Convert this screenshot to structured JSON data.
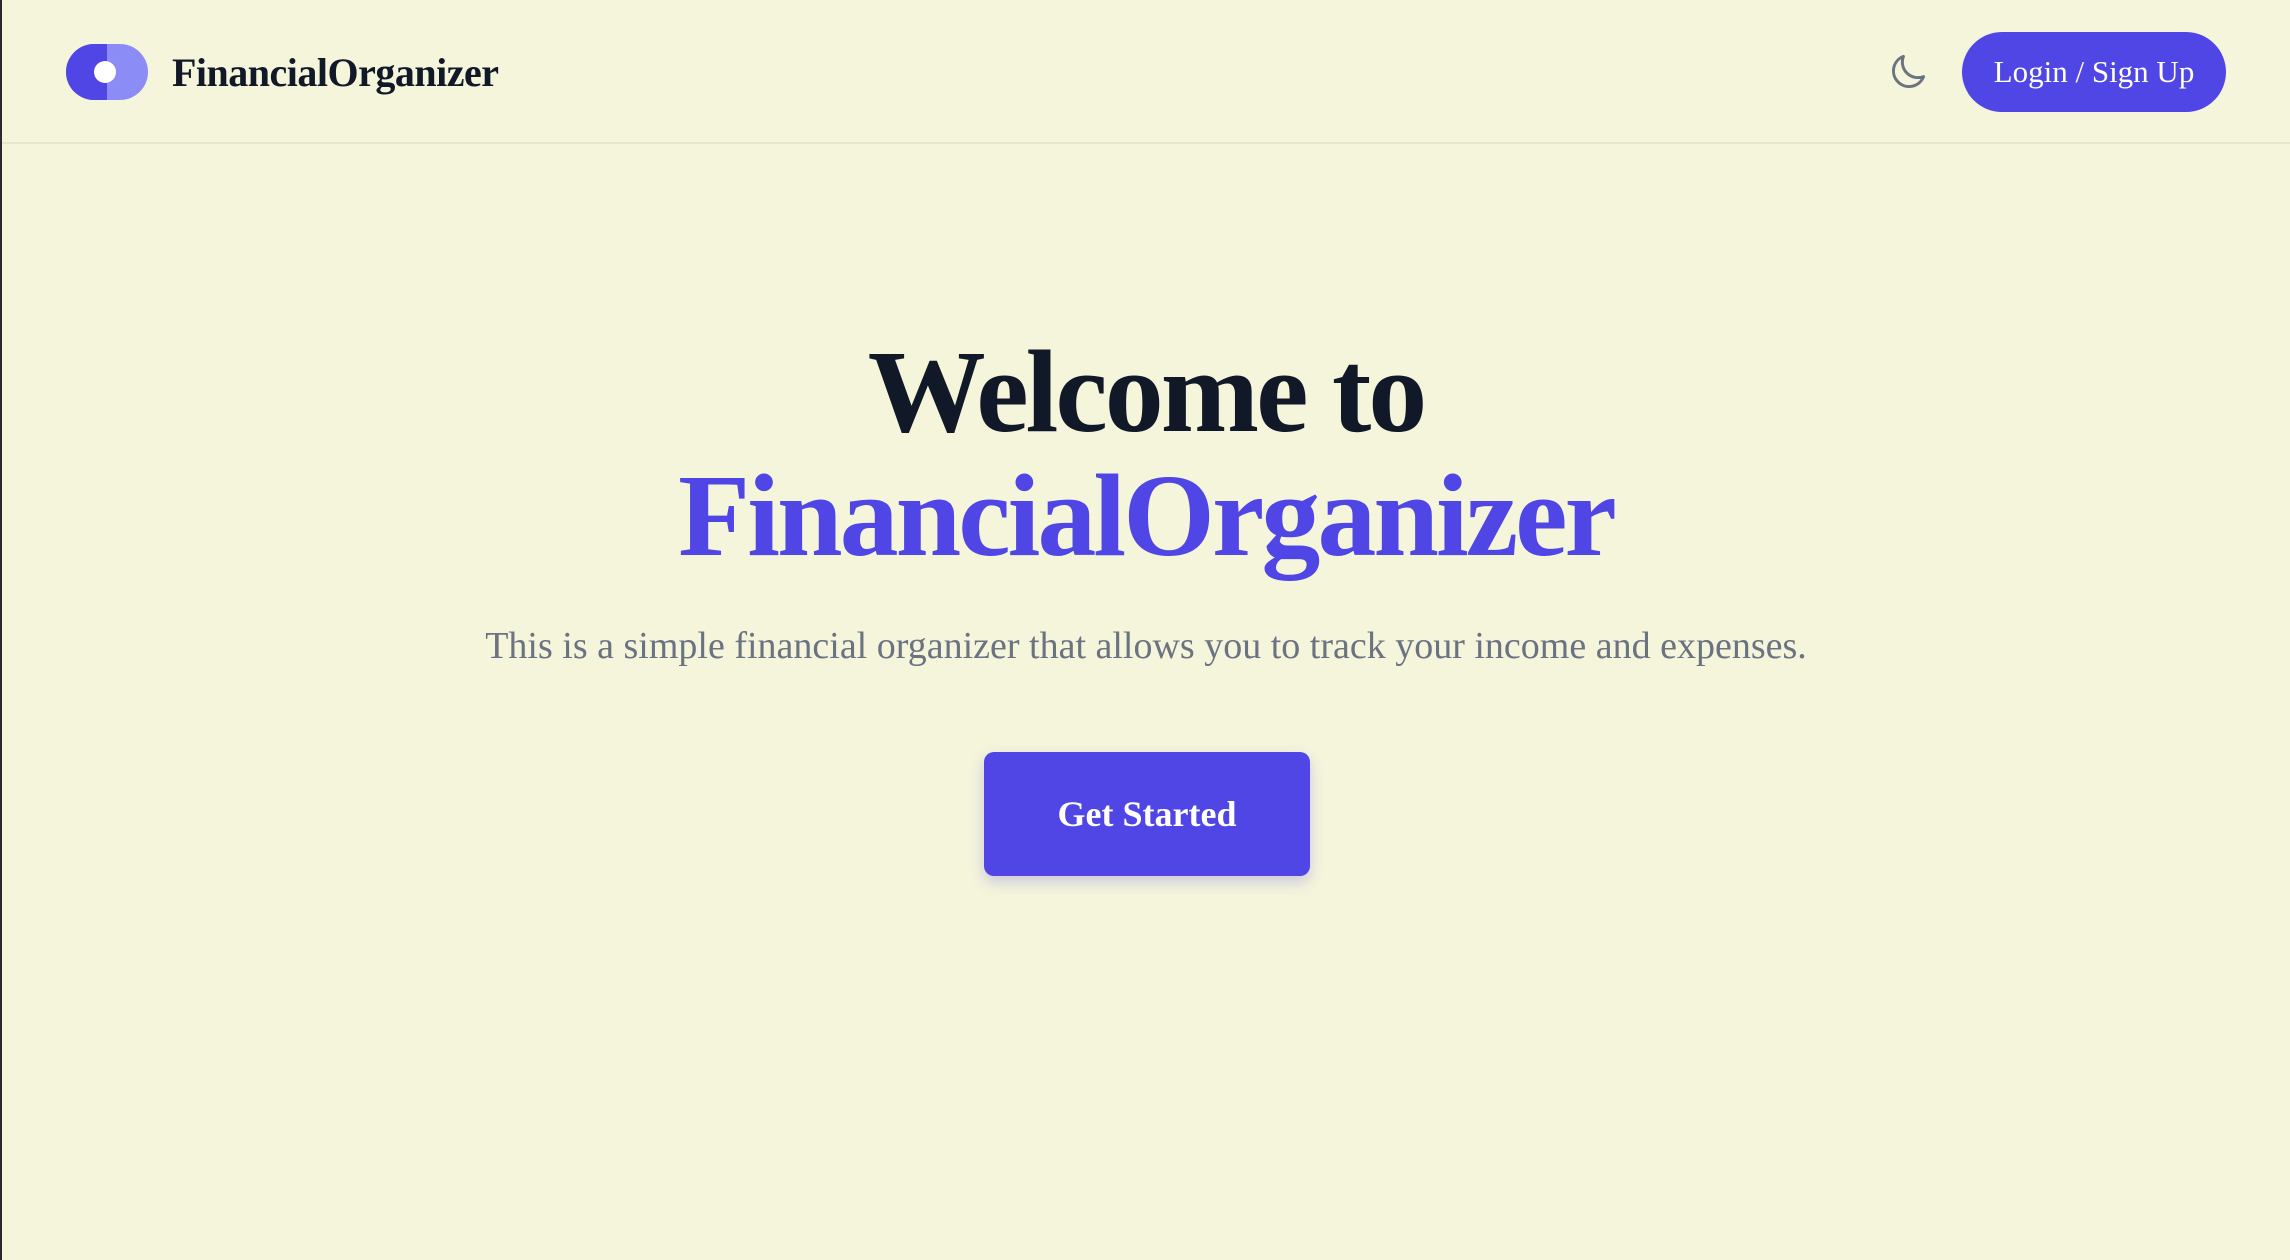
{
  "header": {
    "brand_name": "FinancialOrganizer",
    "logo_icon": "toggle-logo-icon",
    "theme_toggle_icon": "moon-icon",
    "login_label": "Login / Sign Up"
  },
  "hero": {
    "title_line1": "Welcome to",
    "title_line2": "FinancialOrganizer",
    "subtitle": "This is a simple financial organizer that allows you to track your income and expenses.",
    "cta_label": "Get Started"
  },
  "colors": {
    "background": "#f5f5dc",
    "accent": "#4f46e5",
    "accent_light": "#8b8cf5",
    "text_dark": "#111827",
    "text_muted": "#6b7280"
  }
}
